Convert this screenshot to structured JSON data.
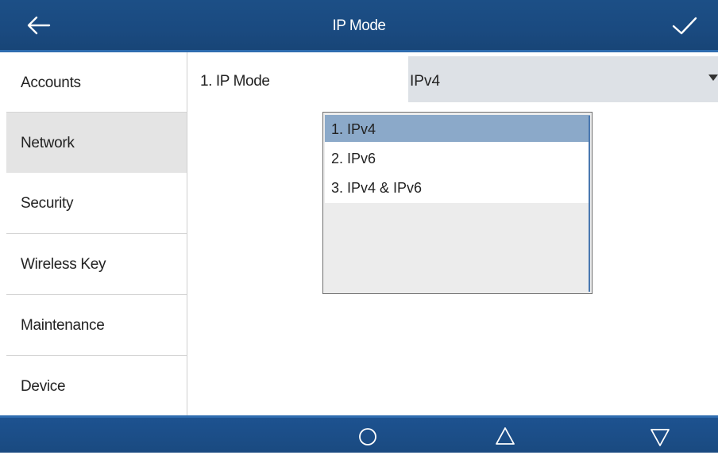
{
  "header": {
    "title": "IP Mode",
    "back_icon": "arrow-left-icon",
    "confirm_icon": "checkmark-icon"
  },
  "sidebar": {
    "items": [
      {
        "label": "Accounts",
        "active": false
      },
      {
        "label": "Network",
        "active": true
      },
      {
        "label": "Security",
        "active": false
      },
      {
        "label": "Wireless Key",
        "active": false
      },
      {
        "label": "Maintenance",
        "active": false
      },
      {
        "label": "Device",
        "active": false
      }
    ]
  },
  "form": {
    "field_label": "1. IP Mode",
    "selected_value": "IPv4",
    "options": [
      "1. IPv4",
      "2. IPv6",
      "3. IPv4 & IPv6"
    ],
    "highlighted_option_index": 0
  },
  "bottom_nav": {
    "icons": [
      "circle-home-icon",
      "triangle-up-icon",
      "triangle-down-icon"
    ]
  },
  "colors": {
    "bar": "#1a4a80",
    "accent": "#2f6db0",
    "highlight": "#8ba9c9",
    "select_bg": "#dde1e6"
  }
}
